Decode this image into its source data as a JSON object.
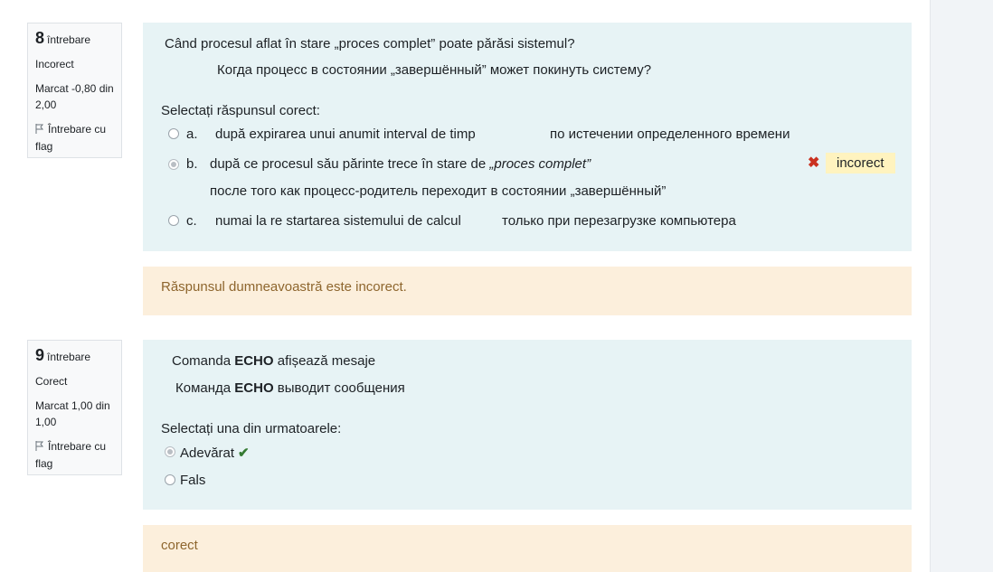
{
  "questions": [
    {
      "number": "8",
      "number_label": "întrebare",
      "status": "Incorect",
      "mark": "Marcat -0,80 din 2,00",
      "flag_label": "Întrebare cu flag",
      "question_ro": "Când procesul aflat în stare „proces complet” poate părăsi sistemul?",
      "question_ru": "Когда процесс в состоянии  „завершённый” может покинуть систему?",
      "prompt": "Selectați răspunsul corect:",
      "options": [
        {
          "letter": "a.",
          "text_ro": "după expirarea unui anumit interval de timp",
          "text_ru": "по  истечении определенного времени",
          "selected": false
        },
        {
          "letter": "b.",
          "text_ro_prefix": "după ce procesul său părinte trece în stare de ",
          "text_ro_italic": "„proces complet”",
          "text_ru": "после того как процесс-родитель переходит в состоянии „завершённый”",
          "selected": true,
          "result_icon": "x-icon",
          "result_label": "incorect"
        },
        {
          "letter": "c.",
          "text_ro": "numai la re startarea sistemului de calcul",
          "text_ru": "только при перезагрузке компьютера",
          "selected": false
        }
      ],
      "feedback": "Răspunsul dumneavoastră este incorect."
    },
    {
      "number": "9",
      "number_label": "întrebare",
      "status": "Corect",
      "mark": "Marcat 1,00 din 1,00",
      "flag_label": "Întrebare cu flag",
      "q_ro_pre": "Comanda ",
      "q_ro_bold": "ECHO",
      "q_ro_post": " afișează mesaje",
      "q_ru_pre": "Команда  ",
      "q_ru_bold": "ECHO",
      "q_ru_post": " выводит сообщения",
      "prompt": "Selectați una din urmatoarele:",
      "options": [
        {
          "text": "Adevărat",
          "selected": true,
          "result_icon": "check-icon"
        },
        {
          "text": "Fals",
          "selected": false
        }
      ],
      "feedback": "corect"
    }
  ],
  "colors": {
    "info_bg": "#f8f9fa",
    "formulation_bg": "#e7f3f5",
    "feedback_bg": "#fcefdc",
    "feedback_text": "#8e662e",
    "incorrect": "#ca3120",
    "correct": "#357a32",
    "badge_bg": "#fff3bf"
  }
}
